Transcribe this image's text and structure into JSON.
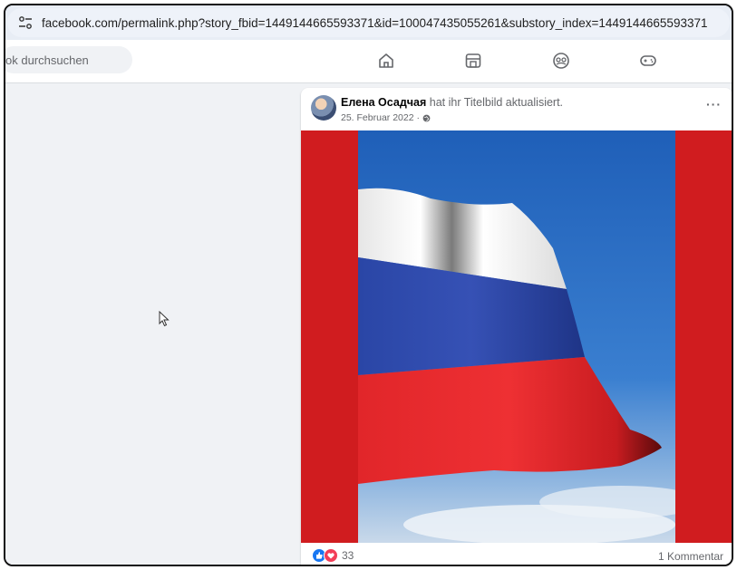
{
  "browser": {
    "url": "facebook.com/permalink.php?story_fbid=1449144665593371&id=100047435055261&substory_index=1449144665593371"
  },
  "navbar": {
    "search_placeholder": "ok durchsuchen",
    "icons": [
      "home-icon",
      "marketplace-icon",
      "groups-icon",
      "gaming-icon"
    ]
  },
  "post": {
    "author": "Елена Осадчая",
    "action": " hat ihr Titelbild aktualisiert.",
    "date": "25. Februar 2022 ·",
    "more": "···",
    "reaction_count": "33",
    "comments": "1 Kommentar"
  },
  "colors": {
    "flag_white": "#f7f7f7",
    "flag_blue": "#2b47a8",
    "flag_red": "#e3262b",
    "cover_background": "#d01c1f",
    "sky": "#2f74c9",
    "like_blue": "#1877f2",
    "love_red": "#f33e58"
  }
}
